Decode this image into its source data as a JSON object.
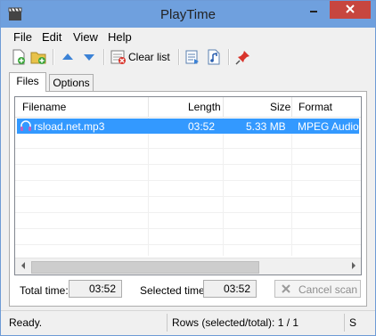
{
  "window": {
    "title": "PlayTime"
  },
  "menu": {
    "items": [
      "File",
      "Edit",
      "View",
      "Help"
    ]
  },
  "toolbar": {
    "clear_label": "Clear list"
  },
  "tabs": [
    {
      "label": "Files",
      "active": true
    },
    {
      "label": "Options",
      "active": false
    }
  ],
  "list": {
    "columns": [
      "Filename",
      "Length",
      "Size",
      "Format"
    ],
    "rows": [
      {
        "filename": "rsload.net.mp3",
        "length": "03:52",
        "size": "5.33 MB",
        "format": "MPEG Audio",
        "selected": true
      }
    ]
  },
  "bottom": {
    "total_time_label": "Total time:",
    "total_time_value": "03:52",
    "selected_time_label": "Selected time:",
    "selected_time_value": "03:52",
    "cancel_label": "Cancel scan"
  },
  "status": {
    "ready": "Ready.",
    "rows": "Rows (selected/total): 1 / 1",
    "extra": "S"
  },
  "colors": {
    "selection": "#3399ff",
    "titlebar": "#6fa0de",
    "close": "#c7463f"
  }
}
